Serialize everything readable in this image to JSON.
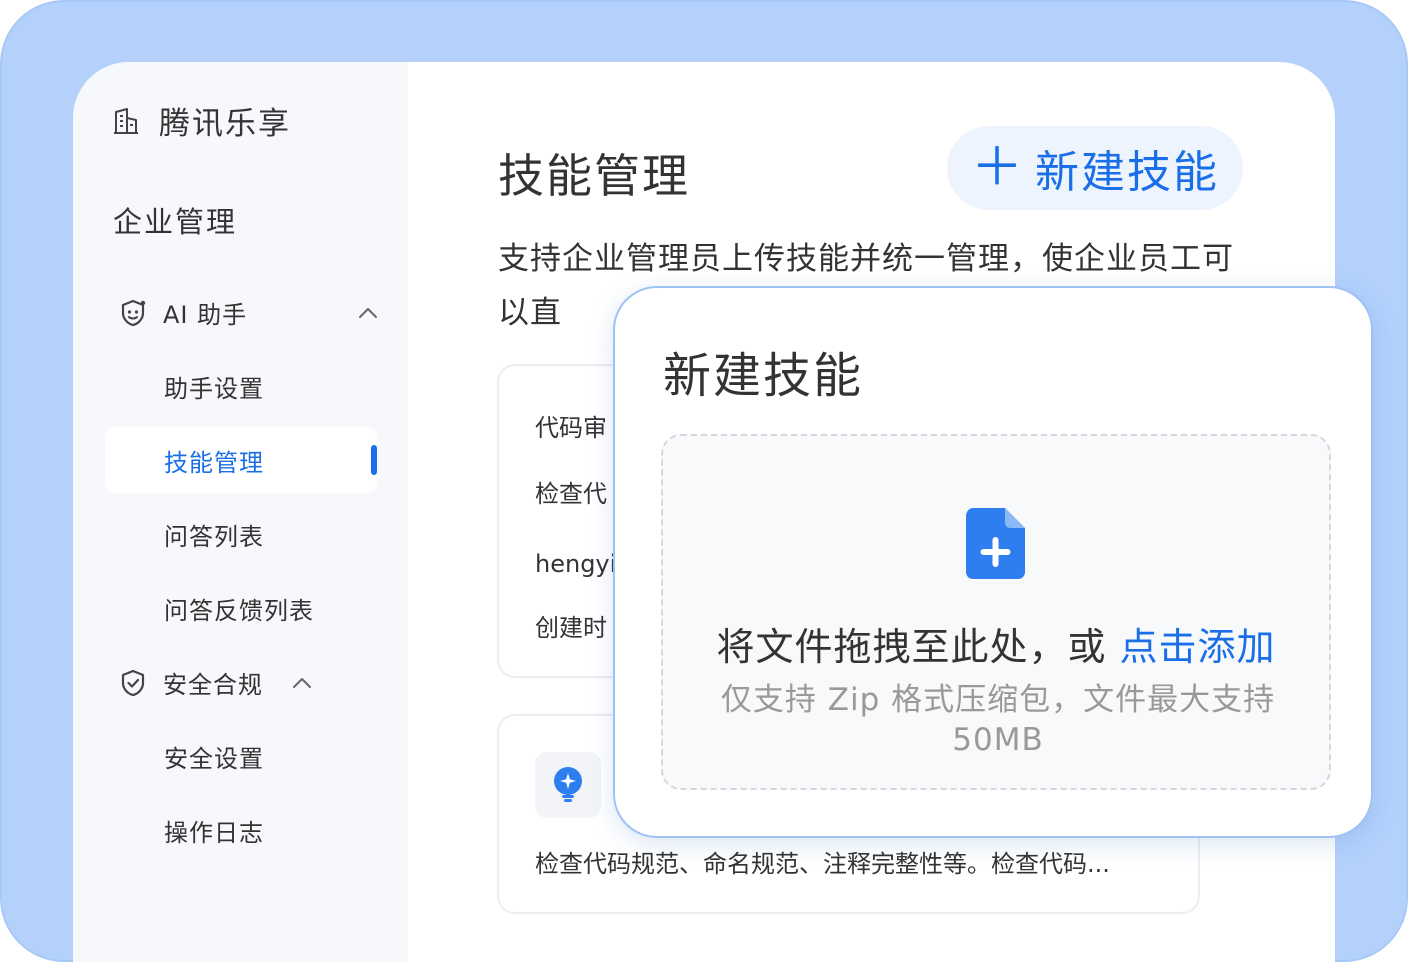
{
  "colors": {
    "accent": "#1a6fe8",
    "frame": "#b3d1fb",
    "sidebar_bg": "#f6f8fb"
  },
  "sidebar": {
    "org_name": "腾讯乐享",
    "org_icon": "building-icon",
    "section_title": "企业管理",
    "groups": [
      {
        "label": "AI 助手",
        "icon": "ai-face-icon",
        "expanded": true,
        "items": [
          "助手设置",
          "技能管理",
          "问答列表",
          "问答反馈列表"
        ]
      },
      {
        "label": "安全合规",
        "icon": "shield-check-icon",
        "expanded": true,
        "items": [
          "安全设置",
          "操作日志"
        ]
      }
    ],
    "active_item": "技能管理"
  },
  "main": {
    "title": "技能管理",
    "new_button": {
      "icon": "plus-icon",
      "label": "新建技能"
    },
    "description": "支持企业管理员上传技能并统一管理，使企业员工可以直",
    "cards": [
      {
        "title": "代码审",
        "desc": "检查代",
        "author": "hengyi",
        "created": "创建时"
      },
      {
        "icon": "lightbulb-sparkle-icon",
        "desc": "检查代码规范、命名规范、注释完整性等。检查代码..."
      }
    ]
  },
  "modal": {
    "title": "新建技能",
    "dropzone": {
      "icon": "file-add-icon",
      "prompt": "将文件拖拽至此处，或",
      "link": "点击添加",
      "hint": "仅支持 Zip 格式压缩包，文件最大支持 50MB"
    }
  }
}
